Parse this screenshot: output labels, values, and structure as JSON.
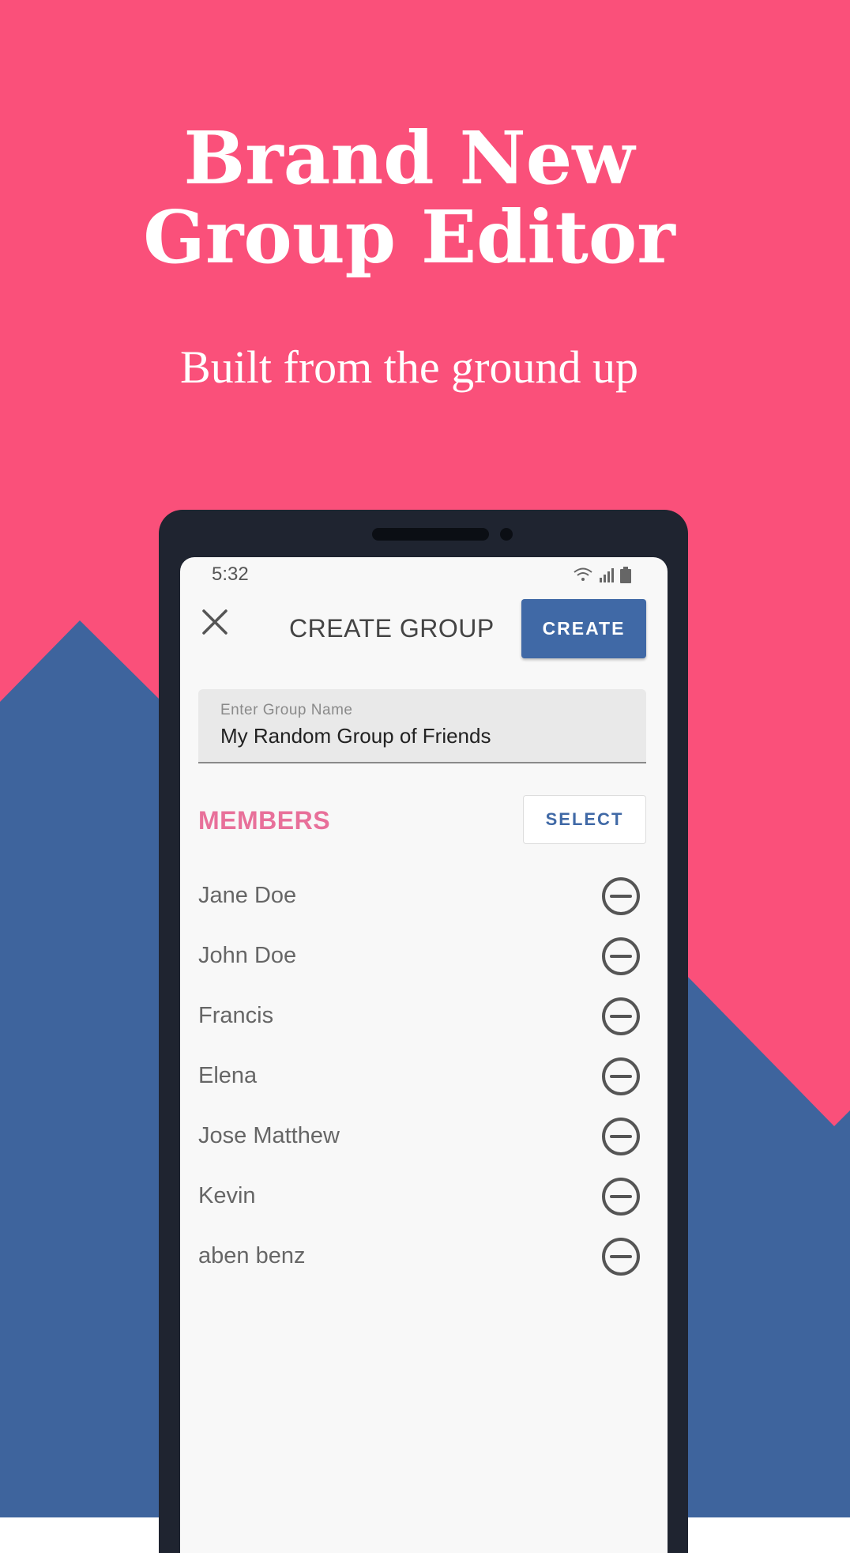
{
  "colors": {
    "background_pink": "#fa507a",
    "background_blue": "#3e649d",
    "accent_blue": "#4069a6",
    "members_pink": "#e8709a",
    "phone_frame": "#1f2430"
  },
  "promo": {
    "headline_line1": "Brand New",
    "headline_line2": "Group Editor",
    "subtitle": "Built from the ground up"
  },
  "statusbar": {
    "time": "5:32",
    "icons": [
      "wifi-icon",
      "signal-icon",
      "battery-icon"
    ]
  },
  "header": {
    "close_icon": "close-icon",
    "title": "CREATE GROUP",
    "create_label": "CREATE"
  },
  "group_name": {
    "label": "Enter Group Name",
    "value": "My Random Group of Friends"
  },
  "members": {
    "title": "MEMBERS",
    "select_label": "SELECT",
    "remove_icon": "remove-circle-icon",
    "items": [
      {
        "name": "Jane Doe"
      },
      {
        "name": "John Doe"
      },
      {
        "name": "Francis"
      },
      {
        "name": "Elena"
      },
      {
        "name": "Jose Matthew"
      },
      {
        "name": "Kevin"
      },
      {
        "name": "aben benz"
      }
    ]
  }
}
